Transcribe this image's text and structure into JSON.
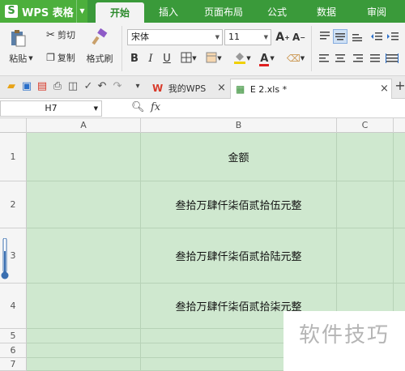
{
  "app": {
    "name": "WPS 表格",
    "logo_letter": "S"
  },
  "ribbon_tabs": [
    "开始",
    "插入",
    "页面布局",
    "公式",
    "数据",
    "审阅"
  ],
  "active_tab": "开始",
  "toolbar": {
    "paste_label": "粘贴",
    "cut_label": "剪切",
    "copy_label": "复制",
    "format_painter_label": "格式刷",
    "font_name": "宋体",
    "font_size": "11",
    "grow_font": "A",
    "shrink_font": "A",
    "bold": "B",
    "italic": "I",
    "underline": "U"
  },
  "doc_tabs": [
    {
      "label": "我的WPS",
      "active": false
    },
    {
      "label": "E 2.xls *",
      "active": true
    }
  ],
  "new_tab_label": "+",
  "close_glyph": "×",
  "formula_bar": {
    "cell_ref": "H7",
    "fx_label": "fx",
    "value": ""
  },
  "columns": [
    "A",
    "B",
    "C"
  ],
  "rows": [
    {
      "num": "1",
      "B": "金额"
    },
    {
      "num": "2",
      "B": "叁拾万肆仟柒佰贰拾伍元整"
    },
    {
      "num": "3",
      "B": "叁拾万肆仟柒佰贰拾陆元整"
    },
    {
      "num": "4",
      "B": "叁拾万肆仟柒佰贰拾柒元整"
    },
    {
      "num": "5",
      "B": ""
    },
    {
      "num": "6",
      "B": ""
    },
    {
      "num": "7",
      "B": ""
    }
  ],
  "watermark": "软件技巧",
  "colors": {
    "accent": "#3a9a3a",
    "cell_fill": "#cfe8cf",
    "font_color_bar": "#e02020",
    "highlight_bar": "#f0d000"
  }
}
